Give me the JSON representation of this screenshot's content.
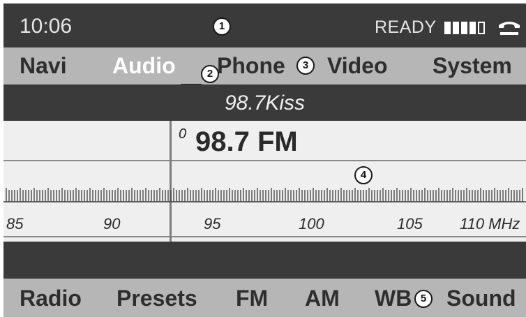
{
  "status_bar": {
    "time": "10:06",
    "ready_label": "READY",
    "signal_bars_filled": 4,
    "signal_bars_total": 5,
    "phone_icon": "handset-hung-up-icon"
  },
  "main_nav": {
    "items": [
      {
        "label": "Navi"
      },
      {
        "label": "Audio",
        "active": true
      },
      {
        "label": "Phone"
      },
      {
        "label": "Video"
      },
      {
        "label": "System"
      }
    ]
  },
  "station": {
    "name": "98.7Kiss"
  },
  "tuner": {
    "preset_marker": "0",
    "frequency": "98.7 FM",
    "scale_labels": [
      "85",
      "90",
      "95",
      "100",
      "105",
      "110 MHz"
    ]
  },
  "sub_nav": {
    "items": [
      {
        "label": "Radio"
      },
      {
        "label": "Presets"
      },
      {
        "label": "FM"
      },
      {
        "label": "AM"
      },
      {
        "label": "WB"
      },
      {
        "label": "Sound"
      }
    ]
  },
  "callouts": [
    "1",
    "2",
    "3",
    "4",
    "5"
  ],
  "colors": {
    "bar_dark": "#3a3a3a",
    "bar_light": "#b6b6b6",
    "tuner_bg": "#efefef",
    "active_text": "#ffffff",
    "text_dark": "#2e2e2e"
  }
}
